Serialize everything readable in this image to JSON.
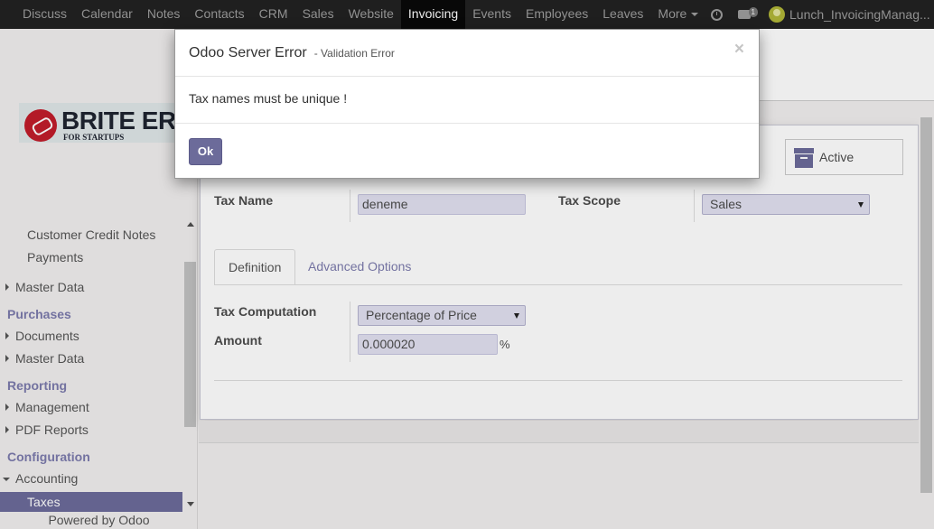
{
  "topbar": {
    "menu": [
      "Discuss",
      "Calendar",
      "Notes",
      "Contacts",
      "CRM",
      "Sales",
      "Website",
      "Invoicing",
      "Events",
      "Employees",
      "Leaves",
      "More"
    ],
    "active_item": "Invoicing",
    "icons": [
      "clock-icon",
      "chat-icon",
      "avatar"
    ],
    "chat_badge": "1",
    "user_name": "Lunch_InvoicingManag..."
  },
  "sidebar": {
    "logo": {
      "title": "BRITE ERP",
      "subtitle": "FOR STARTUPS"
    },
    "items": {
      "customer_credit_notes": "Customer Credit Notes",
      "payments": "Payments",
      "sales_master_data": "Master Data",
      "purchases": "Purchases",
      "documents": "Documents",
      "purchases_master_data": "Master Data",
      "reporting": "Reporting",
      "management": "Management",
      "pdf_reports": "PDF Reports",
      "configuration": "Configuration",
      "accounting": "Accounting",
      "taxes": "Taxes"
    },
    "powered_by": "Powered by Odoo"
  },
  "form": {
    "active_button": "Active",
    "tax_name_label": "Tax Name",
    "tax_name_value": "deneme",
    "tax_scope_label": "Tax Scope",
    "tax_scope_value": "Sales",
    "tabs": [
      "Definition",
      "Advanced Options"
    ],
    "active_tab": "Definition",
    "tax_computation_label": "Tax Computation",
    "tax_computation_value": "Percentage of Price",
    "amount_label": "Amount",
    "amount_value": "0.000020",
    "amount_unit": "%"
  },
  "dialog": {
    "title": "Odoo Server Error",
    "subtitle": "- Validation Error",
    "close": "×",
    "message": "Tax names must be unique !",
    "ok_label": "Ok"
  },
  "colors": {
    "accent": "#6c6b9a",
    "topbar": "#222222",
    "input_bg": "#e1e0f0",
    "section_heading": "#7c7bad"
  }
}
